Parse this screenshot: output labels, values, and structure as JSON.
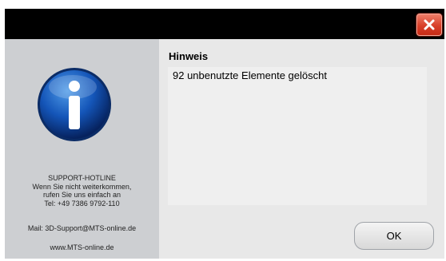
{
  "titlebar": {
    "close_icon": "close-x-icon",
    "close_color": "#d8402a"
  },
  "sidebar": {
    "icon": "info-icon",
    "hotline_title": "SUPPORT-HOTLINE",
    "hotline_line1": "Wenn Sie nicht weiterkommen,",
    "hotline_line2": "rufen Sie uns einfach an",
    "hotline_phone": "Tel: +49 7386 9792-110",
    "mail": "Mail: 3D-Support@MTS-online.de",
    "website": "www.MTS-online.de"
  },
  "content": {
    "heading": "Hinweis",
    "message": "92 unbenutzte Elemente gelöscht",
    "ok_label": "OK"
  }
}
